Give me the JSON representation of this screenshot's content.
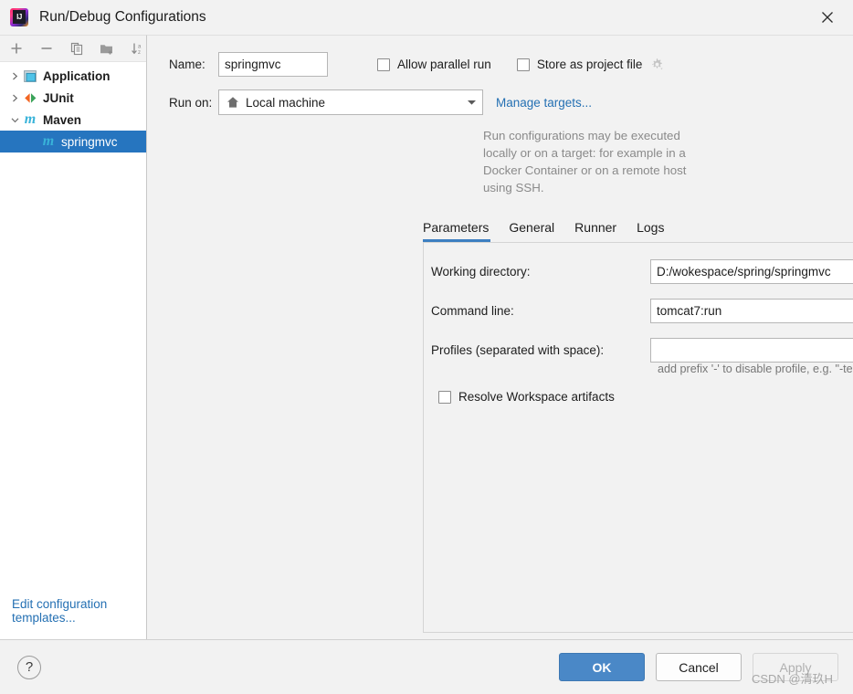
{
  "window": {
    "title": "Run/Debug Configurations",
    "logo_icon": "intellij-idea-logo",
    "close_icon": "close-icon"
  },
  "toolbar": {
    "add_icon": "plus-icon",
    "remove_icon": "minus-icon",
    "copy_icon": "copy-icon",
    "folder_icon": "folder-add-icon",
    "sort_icon": "sort-alphabetical-icon"
  },
  "tree": {
    "items": [
      {
        "label": "Application",
        "icon": "application-window-icon",
        "expanded": false,
        "level": 0,
        "selected": false
      },
      {
        "label": "JUnit",
        "icon": "junit-icon",
        "expanded": false,
        "level": 0,
        "selected": false
      },
      {
        "label": "Maven",
        "icon": "maven-icon",
        "expanded": true,
        "level": 0,
        "selected": false
      },
      {
        "label": "springmvc",
        "icon": "maven-icon",
        "expanded": null,
        "level": 1,
        "selected": true
      }
    ],
    "edit_templates_link": "Edit configuration templates..."
  },
  "form": {
    "name_label": "Name:",
    "name_value": "springmvc",
    "allow_parallel_run_label": "Allow parallel run",
    "allow_parallel_run_checked": false,
    "store_as_project_file_label": "Store as project file",
    "store_as_project_file_checked": false,
    "gear_icon": "gear-dropdown-icon",
    "run_on_label": "Run on:",
    "run_on_value": "Local machine",
    "run_on_icon": "home-icon",
    "manage_targets_link": "Manage targets...",
    "description": "Run configurations may be executed locally or on a target: for example in a Docker Container or on a remote host using SSH."
  },
  "tabs": [
    {
      "label": "Parameters",
      "active": true
    },
    {
      "label": "General",
      "active": false
    },
    {
      "label": "Runner",
      "active": false
    },
    {
      "label": "Logs",
      "active": false
    }
  ],
  "parameters": {
    "working_directory_label": "Working directory:",
    "working_directory_value": "D:/wokespace/spring/springmvc",
    "browse_icon": "folder-open-icon",
    "module_icon": "module-folder-icon",
    "command_line_label": "Command line:",
    "command_line_value": "tomcat7:run",
    "profiles_label": "Profiles (separated with space):",
    "profiles_value": "",
    "profiles_hint": "add prefix '-' to disable profile, e.g. \"-test\"",
    "resolve_workspace_label": "Resolve Workspace artifacts",
    "resolve_workspace_checked": false
  },
  "footer": {
    "help_label": "?",
    "ok_label": "OK",
    "cancel_label": "Cancel",
    "apply_label": "Apply",
    "apply_enabled": false
  },
  "watermark": "CSDN @清玖H",
  "colors": {
    "accent": "#2675bf",
    "primary_button": "#4a88c7",
    "link": "#2470b3",
    "maven_cyan": "#38b3d9",
    "tab_underline": "#3d7fc1"
  }
}
